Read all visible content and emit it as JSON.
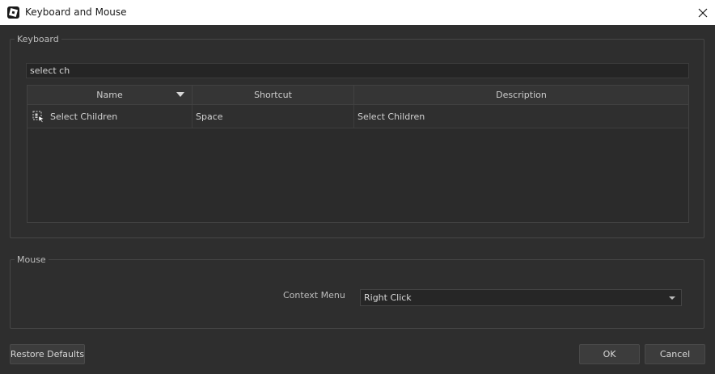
{
  "window": {
    "title": "Keyboard and Mouse"
  },
  "keyboard": {
    "group_title": "Keyboard",
    "filter_value": "select ch",
    "columns": [
      "Name",
      "Shortcut",
      "Description"
    ],
    "rows": [
      {
        "name": "Select Children",
        "shortcut": "Space",
        "description": "Select Children",
        "icon": "select-children-icon"
      }
    ]
  },
  "mouse": {
    "group_title": "Mouse",
    "context_menu_label": "Context Menu",
    "context_menu_value": "Right Click"
  },
  "buttons": {
    "restore_defaults": "Restore Defaults",
    "ok": "OK",
    "cancel": "Cancel"
  },
  "colors": {
    "background": "#2e2e2e",
    "titlebar": "#ffffff",
    "input_bg": "#252525",
    "button_bg": "#3c3c3c"
  }
}
